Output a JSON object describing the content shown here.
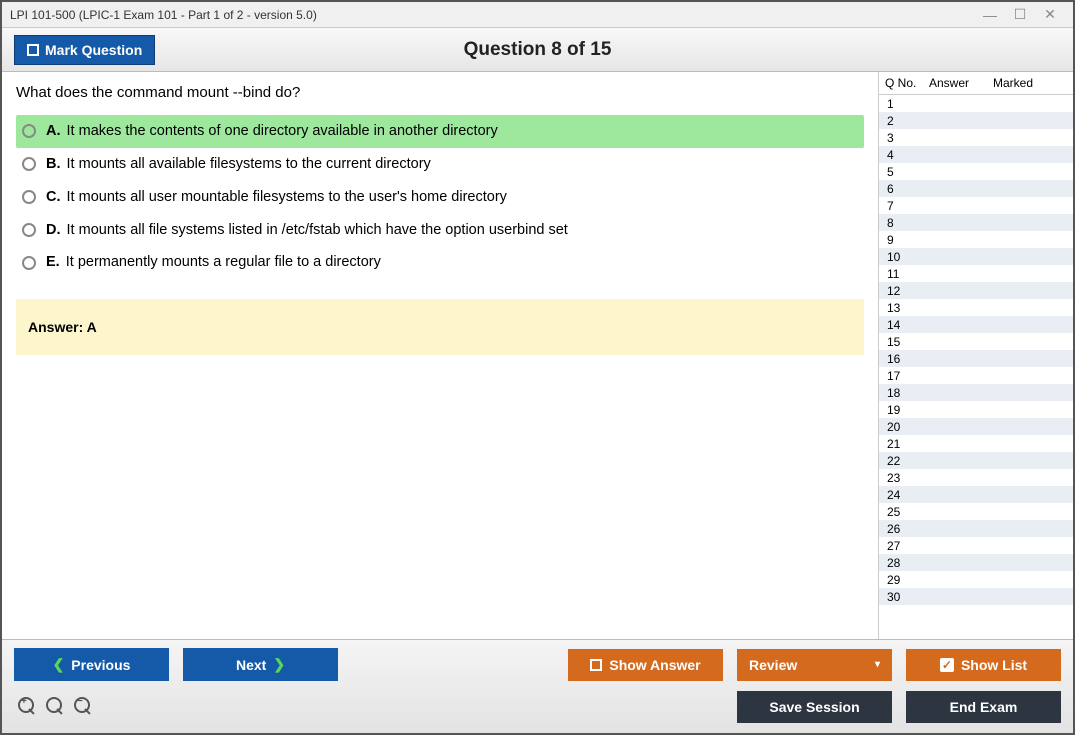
{
  "title": "LPI 101-500 (LPIC-1 Exam 101 - Part 1 of 2 - version 5.0)",
  "topbar": {
    "mark_label": "Mark Question",
    "counter": "Question 8 of 15"
  },
  "question": {
    "text": "What does the command mount --bind do?",
    "options": [
      {
        "letter": "A.",
        "text": "It makes the contents of one directory available in another directory",
        "correct": true
      },
      {
        "letter": "B.",
        "text": "It mounts all available filesystems to the current directory",
        "correct": false
      },
      {
        "letter": "C.",
        "text": "It mounts all user mountable filesystems to the user's home directory",
        "correct": false
      },
      {
        "letter": "D.",
        "text": "It mounts all file systems listed in /etc/fstab which have the option userbind set",
        "correct": false
      },
      {
        "letter": "E.",
        "text": "It permanently mounts a regular file to a directory",
        "correct": false
      }
    ],
    "answer_label": "Answer: A"
  },
  "sidebar": {
    "headers": {
      "qno": "Q No.",
      "answer": "Answer",
      "marked": "Marked"
    },
    "rows": [
      {
        "n": "1"
      },
      {
        "n": "2"
      },
      {
        "n": "3"
      },
      {
        "n": "4"
      },
      {
        "n": "5"
      },
      {
        "n": "6"
      },
      {
        "n": "7"
      },
      {
        "n": "8"
      },
      {
        "n": "9"
      },
      {
        "n": "10"
      },
      {
        "n": "11"
      },
      {
        "n": "12"
      },
      {
        "n": "13"
      },
      {
        "n": "14"
      },
      {
        "n": "15"
      },
      {
        "n": "16"
      },
      {
        "n": "17"
      },
      {
        "n": "18"
      },
      {
        "n": "19"
      },
      {
        "n": "20"
      },
      {
        "n": "21"
      },
      {
        "n": "22"
      },
      {
        "n": "23"
      },
      {
        "n": "24"
      },
      {
        "n": "25"
      },
      {
        "n": "26"
      },
      {
        "n": "27"
      },
      {
        "n": "28"
      },
      {
        "n": "29"
      },
      {
        "n": "30"
      }
    ]
  },
  "buttons": {
    "previous": "Previous",
    "next": "Next",
    "show_answer": "Show Answer",
    "review": "Review",
    "show_list": "Show List",
    "save_session": "Save Session",
    "end_exam": "End Exam"
  }
}
